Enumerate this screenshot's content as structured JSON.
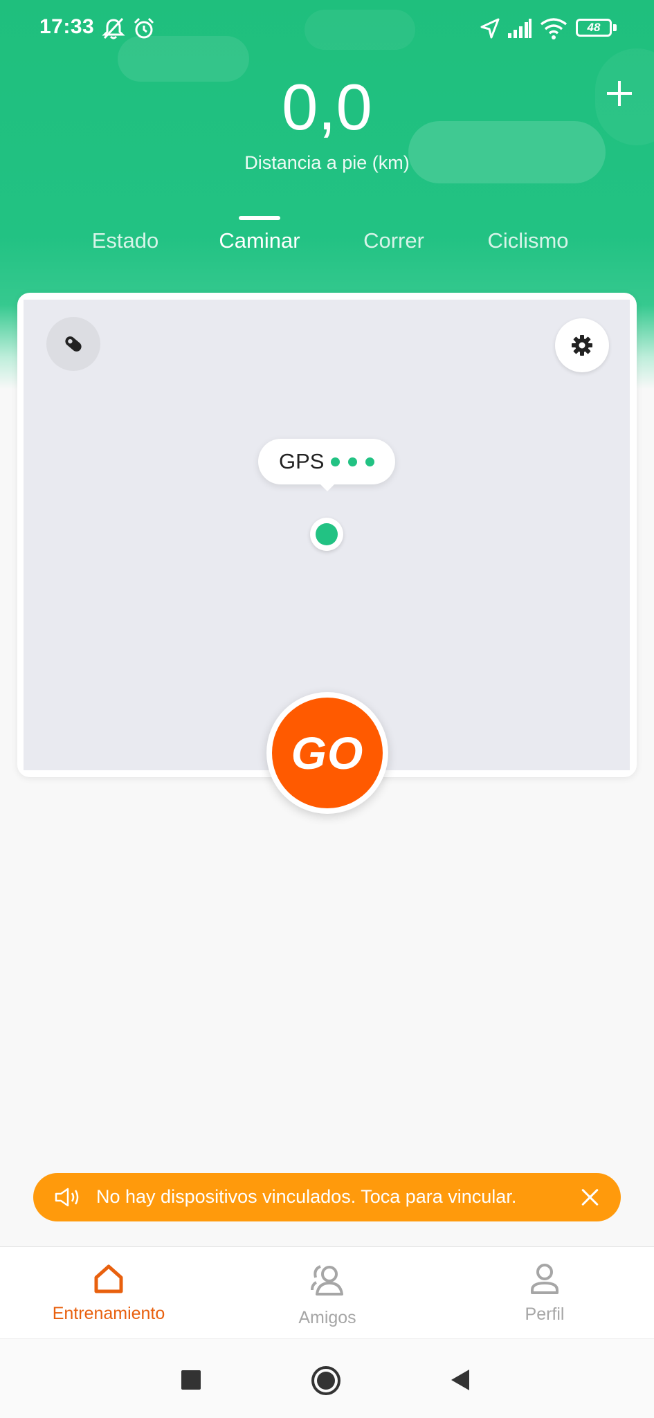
{
  "status_bar": {
    "time": "17:33",
    "battery": "48"
  },
  "header": {
    "distance_value": "0,0",
    "distance_label": "Distancia a pie (km)",
    "add_icon": "plus-icon"
  },
  "tabs": [
    {
      "label": "Estado",
      "active": false
    },
    {
      "label": "Caminar",
      "active": true
    },
    {
      "label": "Correr",
      "active": false
    },
    {
      "label": "Ciclismo",
      "active": false
    }
  ],
  "map": {
    "gps_label": "GPS",
    "go_label": "GO"
  },
  "banner": {
    "text": "No hay dispositivos vinculados. Toca para vincular."
  },
  "bottom_nav": [
    {
      "label": "Entrenamiento",
      "icon": "home-icon",
      "active": true
    },
    {
      "label": "Amigos",
      "icon": "friends-icon",
      "active": false
    },
    {
      "label": "Perfil",
      "icon": "profile-icon",
      "active": false
    }
  ],
  "colors": {
    "accent_green": "#22c283",
    "go_orange": "#ff5a00",
    "banner_orange": "#ff9a0c",
    "nav_active": "#e8600e",
    "nav_inactive": "#a6a6a6"
  }
}
